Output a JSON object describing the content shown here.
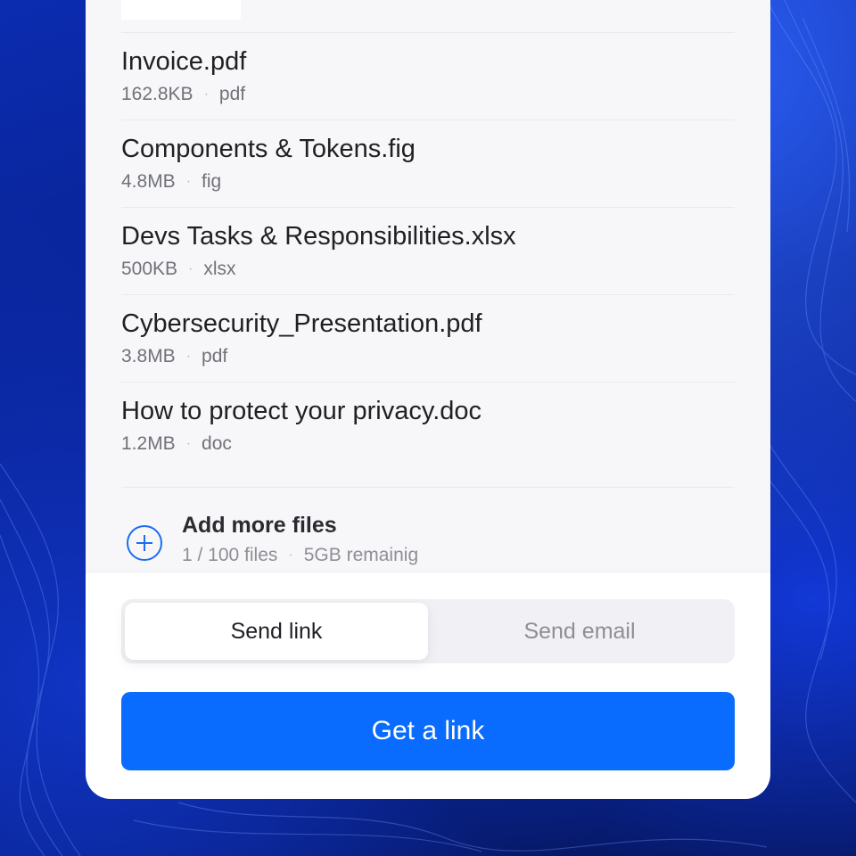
{
  "files": [
    {
      "name": "Invoice.pdf",
      "size": "162.8KB",
      "type": "pdf"
    },
    {
      "name": "Components & Tokens.fig",
      "size": "4.8MB",
      "type": "fig"
    },
    {
      "name": "Devs Tasks & Responsibilities.xlsx",
      "size": "500KB",
      "type": "xlsx"
    },
    {
      "name": "Cybersecurity_Presentation.pdf",
      "size": "3.8MB",
      "type": "pdf"
    },
    {
      "name": "How to protect your privacy.doc",
      "size": "1.2MB",
      "type": "doc"
    }
  ],
  "meta_separator": "·",
  "add_more": {
    "title": "Add more files",
    "count": "1 / 100 files",
    "remaining": "5GB remainig",
    "icon": "plus-circle-icon"
  },
  "segmented": {
    "active_label": "Send link",
    "inactive_label": "Send email"
  },
  "cta": {
    "label": "Get a link"
  },
  "colors": {
    "accent": "#0a6bff",
    "icon_blue": "#1b6cf2"
  }
}
